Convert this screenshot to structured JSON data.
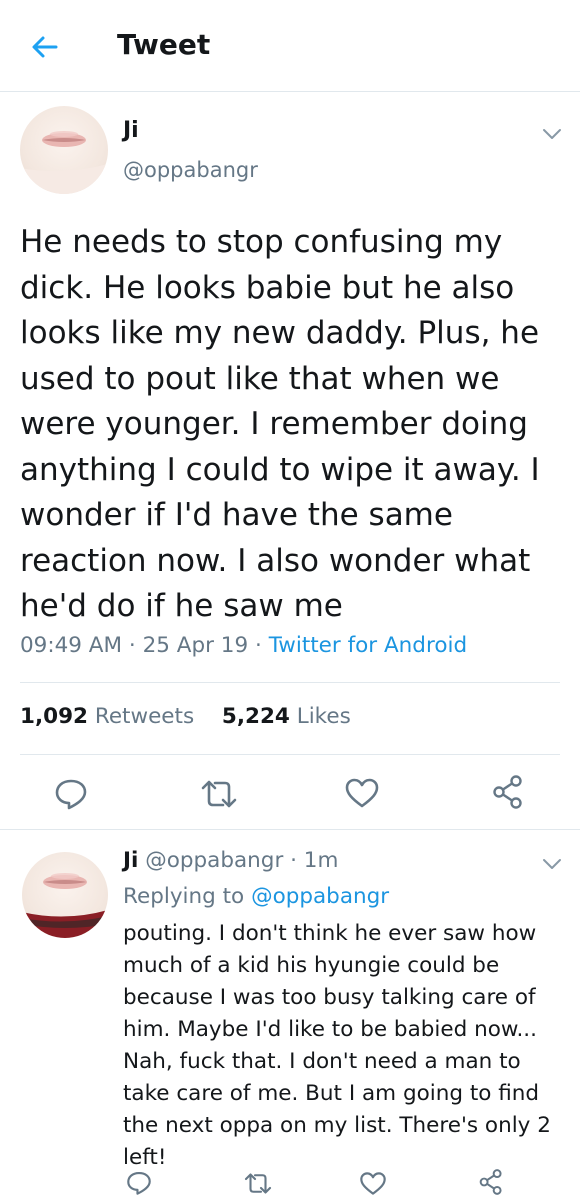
{
  "header": {
    "title": "Tweet",
    "back_icon": "back-arrow-icon",
    "accent": "#1da1f2"
  },
  "tweet": {
    "name": "Ji",
    "handle": "@oppabangr",
    "text": "He needs to stop confusing my dick. He looks babie but he also looks like my new daddy. Plus, he used to pout like that when we were younger. I remember doing anything I could to wipe it away. I wonder if I'd have the same reaction now. I also wonder what he'd do if he saw me",
    "time": "09:49 AM",
    "date": "25 Apr 19",
    "source": "Twitter for Android",
    "retweets_count": "1,092",
    "retweets_label": "Retweets",
    "likes_count": "5,224",
    "likes_label": "Likes"
  },
  "reply": {
    "name": "Ji",
    "handle": "@oppabangr",
    "age": "1m",
    "replying_label": "Replying to",
    "replying_to": "@oppabangr",
    "text": "pouting. I don't think he ever saw how much of a kid his hyungie could be because I was too busy talking care of him. Maybe I'd like to be babied now... Nah, fuck that. I don't need a man to take care of me. But I am going to find the next oppa on my list. There's only 2 left!"
  },
  "actions": [
    "reply-icon",
    "retweet-icon",
    "like-icon",
    "share-icon"
  ],
  "colors": {
    "text": "#14171a",
    "secondary": "#657786",
    "link": "#1b95e0",
    "divider": "#e1e8ed"
  }
}
